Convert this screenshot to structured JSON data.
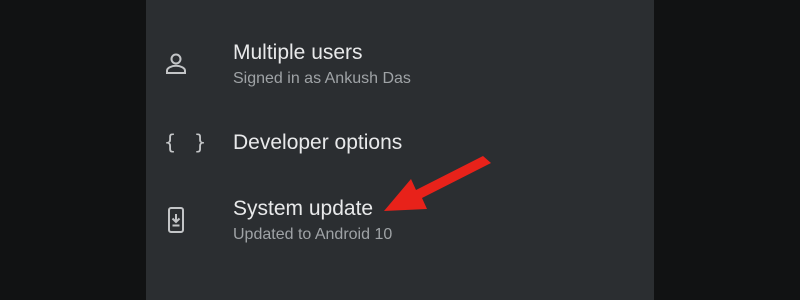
{
  "settings": {
    "items": [
      {
        "icon": "person-icon",
        "title": "Multiple users",
        "subtitle": "Signed in as Ankush Das"
      },
      {
        "icon": "braces-icon",
        "title": "Developer options",
        "glyph": "{ }"
      },
      {
        "icon": "system-update-icon",
        "title": "System update",
        "subtitle": "Updated to Android 10"
      }
    ]
  },
  "annotation": {
    "arrow_color": "#e8221a"
  },
  "colors": {
    "screen_background": "#2b2e31",
    "outer_background": "#111213",
    "title_text": "#e8e9ea",
    "subtitle_text": "#9fa3a6",
    "icon": "#c3c5c7"
  }
}
